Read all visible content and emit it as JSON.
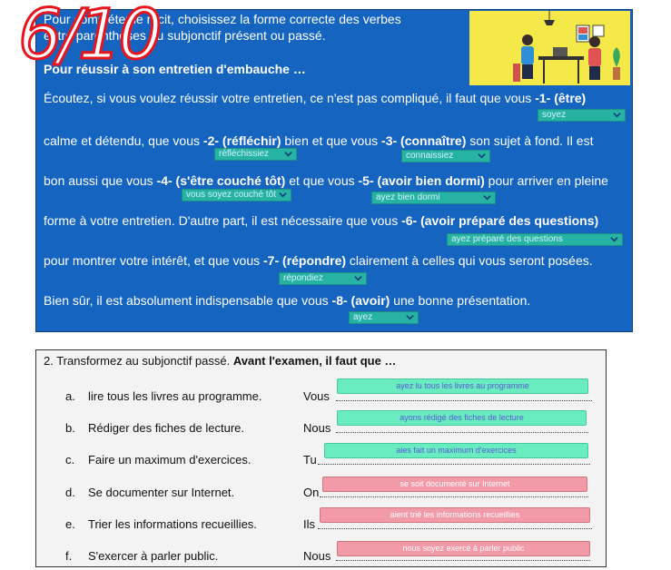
{
  "exercise1": {
    "intro_line1": "Pour compléter le récit, choisissez la forme correcte des verbes",
    "intro_line2": "entre parenthèses au subjonctif présent ou passé.",
    "heading": "Pour réussir à son entretien d'embauche …",
    "line1": {
      "text": "Écoutez, si vous voulez réussir votre entretien, ce n'est pas compliqué, il faut que vous ",
      "num": "-1-",
      "verb": "(être)"
    },
    "line2": {
      "a": "calme et détendu, que vous ",
      "num2": "-2-",
      "verb2": "(réfléchir)",
      "b": " bien et que vous ",
      "num3": "-3-",
      "verb3": "(connaître)",
      "c": " son sujet à fond. Il est"
    },
    "line3": {
      "a": "bon aussi que vous ",
      "num4": "-4-",
      "verb4": "(s'être couché tôt)",
      "b": " et que vous ",
      "num5": "-5-",
      "verb5": "(avoir bien dormi)",
      "c": " pour arriver en pleine"
    },
    "line4": {
      "a": "forme à votre entretien. D'autre part, il est nécessaire que vous ",
      "num6": "-6-",
      "verb6": "(avoir préparé des questions)"
    },
    "line5": {
      "a": "pour montrer votre intérêt, et que vous ",
      "num7": "-7-",
      "verb7": "(répondre)",
      "b": " clairement à celles qui vous seront posées."
    },
    "line6": {
      "a": "Bien sûr, il est absolument indispensable que vous ",
      "num8": "-8-",
      "verb8": "(avoir)",
      "b": " une bonne présentation."
    },
    "dropdowns": {
      "d1": "soyez",
      "d2": "réfléchissiez",
      "d3": "connaissiez",
      "d4": "vous soyez couché tôt",
      "d5": "ayez bien dormi",
      "d6": "ayez préparé des questions",
      "d7": "répondiez",
      "d8": "ayez"
    },
    "score": "6/10"
  },
  "exercise2": {
    "title_plain": "2. Transformez au subjonctif passé. ",
    "title_bold": "Avant l'examen, il faut que …",
    "rows": [
      {
        "letter": "a.",
        "instruction": "lire tous les livres au programme.",
        "pronoun": "Vous",
        "answer": "ayez lu tous les livres au programme",
        "status": "correct"
      },
      {
        "letter": "b.",
        "instruction": "Rédiger des fiches de lecture.",
        "pronoun": "Nous",
        "answer": "ayons rédigé des fiches de lecture",
        "status": "correct"
      },
      {
        "letter": "c.",
        "instruction": "Faire un maximum d'exercices.",
        "pronoun": "Tu",
        "answer": "aies fait un maximum d'exercices",
        "status": "correct"
      },
      {
        "letter": "d.",
        "instruction": "Se documenter sur Internet.",
        "pronoun": "On",
        "answer": "se soit documenté sur Internet",
        "status": "incorrect"
      },
      {
        "letter": "e.",
        "instruction": "Trier les informations recueillies.",
        "pronoun": "Ils",
        "answer": "aient trié les informations recueillies",
        "status": "incorrect"
      },
      {
        "letter": "f.",
        "instruction": "S'exercer à parler public.",
        "pronoun": "Nous",
        "answer": "nous soyez exercé à parler public",
        "status": "incorrect"
      }
    ]
  },
  "colors": {
    "panel_blue": "#1565c0",
    "dropdown_teal": "#26b3a3",
    "answer_correct": "#69ecc0",
    "answer_incorrect": "#f29aa7",
    "score_red": "#e8141e",
    "illustration_yellow": "#f5e94a"
  },
  "icons": [
    "chevron-down-icon",
    "office-illustration"
  ]
}
